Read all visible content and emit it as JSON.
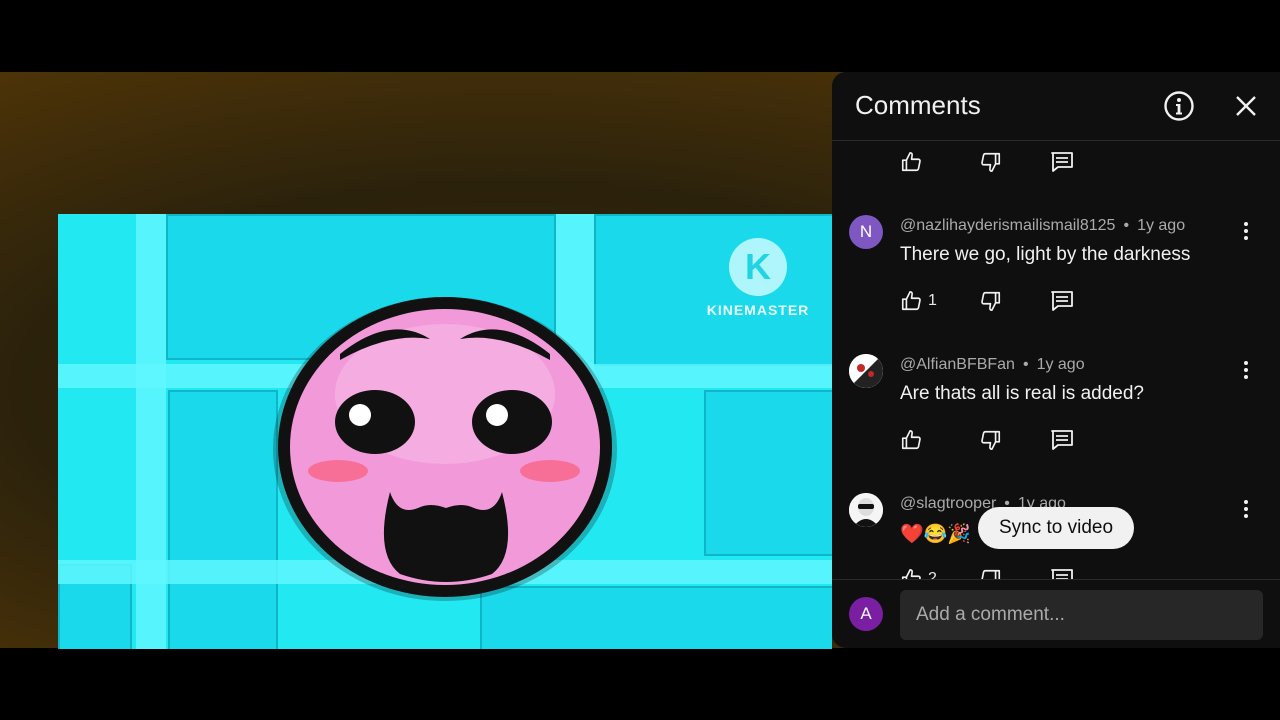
{
  "video": {
    "watermark_text": "KINEMASTER",
    "watermark_letter": "K"
  },
  "panel": {
    "title": "Comments",
    "icons": {
      "info": "info-icon",
      "close": "close-icon"
    }
  },
  "top_actions": {
    "like_count": ""
  },
  "comments": [
    {
      "avatar_letter": "N",
      "avatar_color": "#7e57c2",
      "author": "@nazlihayderismailismail8125",
      "time": "1y ago",
      "text": "There we go, light by the darkness",
      "like_count": "1"
    },
    {
      "avatar_letter": "",
      "avatar_color": "#ffffff",
      "author": "@AlfianBFBFan",
      "time": "1y ago",
      "text": "Are thats all is real is added?",
      "like_count": ""
    },
    {
      "avatar_letter": "",
      "avatar_color": "#ffffff",
      "author": "@slagtrooper",
      "time": "1y ago",
      "text": "❤️😂🎉",
      "like_count": "2"
    }
  ],
  "tooltip": {
    "text": "Sync to video"
  },
  "composer": {
    "avatar_letter": "A",
    "placeholder": "Add a comment..."
  },
  "colors": {
    "accent_purple": "#7b1fa2",
    "video_cyan": "#22e8f2",
    "face_pink": "#f29ad9"
  }
}
